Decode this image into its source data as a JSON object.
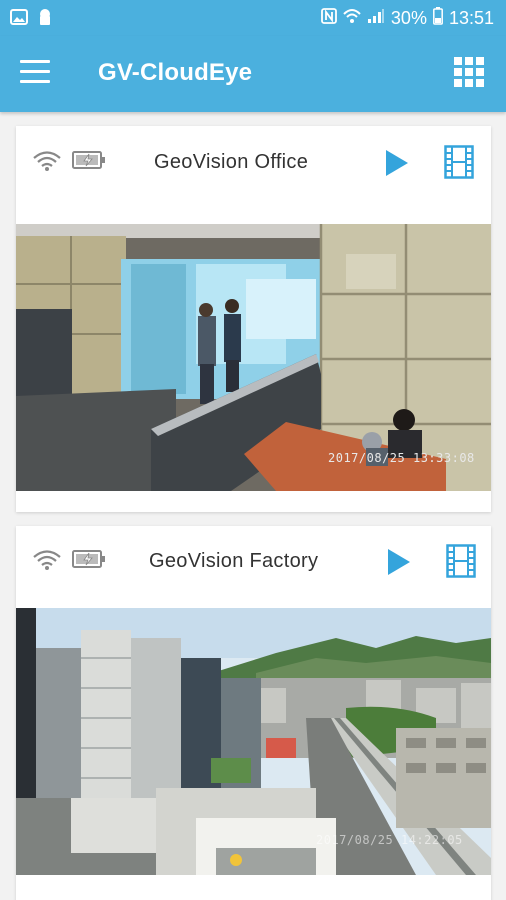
{
  "status_bar": {
    "battery_percent": "30%",
    "time": "13:51",
    "left_icons": [
      "gallery-icon",
      "keyhole-icon"
    ],
    "right_icons": [
      "nfc-icon",
      "wifi-icon",
      "signal-icon",
      "battery-icon"
    ]
  },
  "app_bar": {
    "title": "GV-CloudEye",
    "menu_icon": "hamburger-menu-icon",
    "view_icon": "grid-view-icon",
    "color": "#4bb0de"
  },
  "cameras": [
    {
      "name": "GeoVision Office",
      "feed_timestamp": "2017/08/25  13:33:08",
      "icons": [
        "wifi-icon",
        "battery-charging-icon",
        "play-icon",
        "film-icon"
      ]
    },
    {
      "name": "GeoVision Factory",
      "feed_timestamp": "2017/08/25  14:22:05",
      "icons": [
        "wifi-icon",
        "battery-charging-icon",
        "play-icon",
        "film-icon"
      ]
    }
  ],
  "accent_color": "#34a4dc"
}
